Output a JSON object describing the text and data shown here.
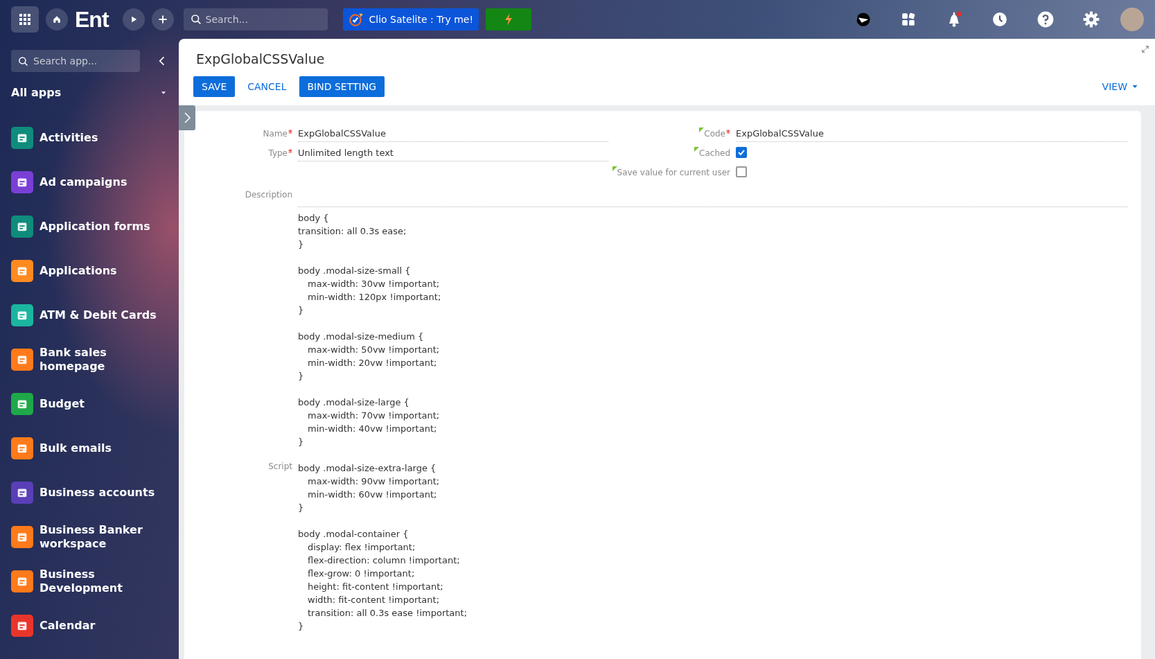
{
  "topbar": {
    "logo": "Ent",
    "search": {
      "placeholder": "Search..."
    },
    "promo_button": "Clio Satelite : Try me!",
    "notification_dot": true
  },
  "sidebar": {
    "search": {
      "placeholder": "Search app..."
    },
    "group": "All apps",
    "items": [
      {
        "label": "Activities",
        "color": "#0f8c7c"
      },
      {
        "label": "Ad campaigns",
        "color": "#7a3fd6"
      },
      {
        "label": "Application forms",
        "color": "#0f8c7c"
      },
      {
        "label": "Applications",
        "color": "#ff8a1f"
      },
      {
        "label": "ATM & Debit Cards",
        "color": "#1bb5a0"
      },
      {
        "label": "Bank sales homepage",
        "color": "#ff7a1a"
      },
      {
        "label": "Budget",
        "color": "#1fa84a"
      },
      {
        "label": "Bulk emails",
        "color": "#ff7a1a"
      },
      {
        "label": "Business accounts",
        "color": "#5a3fb8"
      },
      {
        "label": "Business Banker workspace",
        "color": "#ff7a1a"
      },
      {
        "label": "Business Development",
        "color": "#ff7a1a"
      },
      {
        "label": "Calendar",
        "color": "#e8352c"
      }
    ]
  },
  "page": {
    "title": "ExpGlobalCSSValue",
    "buttons": [
      {
        "label": "SAVE",
        "kind": "primary"
      },
      {
        "label": "CANCEL",
        "kind": "link"
      },
      {
        "label": "BIND SETTING",
        "kind": "primary"
      }
    ],
    "view_button": "VIEW"
  },
  "form": {
    "left_fields": [
      {
        "label": "Name",
        "required": true,
        "marked": false,
        "value": "ExpGlobalCSSValue"
      },
      {
        "label": "Type",
        "required": true,
        "marked": false,
        "value": "Unlimited length text"
      }
    ],
    "right_fields": [
      {
        "label": "Code",
        "kind": "text",
        "required": true,
        "marked": true,
        "value": "ExpGlobalCSSValue"
      },
      {
        "label": "Cached",
        "kind": "checkbox",
        "required": false,
        "marked": true,
        "checked": true
      },
      {
        "label": "Save value for current user",
        "kind": "checkbox",
        "required": false,
        "marked": true,
        "checked": false
      }
    ],
    "description": {
      "label": "Description"
    },
    "script": {
      "label": "Script",
      "blocks": [
        [
          {
            "text": "body {",
            "indent": false
          },
          {
            "text": "transition: all 0.3s ease;",
            "indent": false
          },
          {
            "text": "}",
            "indent": false
          }
        ],
        [
          {
            "text": "body .modal-size-small {",
            "indent": false
          },
          {
            "text": "max-width: 30vw !important;",
            "indent": true
          },
          {
            "text": "min-width: 120px !important;",
            "indent": true
          },
          {
            "text": "}",
            "indent": false
          }
        ],
        [
          {
            "text": "body .modal-size-medium {",
            "indent": false
          },
          {
            "text": "max-width: 50vw !important;",
            "indent": true
          },
          {
            "text": "min-width: 20vw !important;",
            "indent": true
          },
          {
            "text": "}",
            "indent": false
          }
        ],
        [
          {
            "text": "body .modal-size-large {",
            "indent": false
          },
          {
            "text": "max-width: 70vw !important;",
            "indent": true
          },
          {
            "text": "min-width: 40vw !important;",
            "indent": true
          },
          {
            "text": "}",
            "indent": false
          }
        ],
        [
          {
            "text": "body .modal-size-extra-large {",
            "indent": false
          },
          {
            "text": "max-width: 90vw !important;",
            "indent": true
          },
          {
            "text": "min-width: 60vw !important;",
            "indent": true
          },
          {
            "text": "}",
            "indent": false
          }
        ],
        [
          {
            "text": "body .modal-container {",
            "indent": false
          },
          {
            "text": "display: flex !important;",
            "indent": true
          },
          {
            "text": "flex-direction: column !important;",
            "indent": true
          },
          {
            "text": "flex-grow: 0 !important;",
            "indent": true
          },
          {
            "text": "height: fit-content !important;",
            "indent": true
          },
          {
            "text": "width: fit-content !important;",
            "indent": true
          },
          {
            "text": "transition: all 0.3s ease !important;",
            "indent": true
          },
          {
            "text": "}",
            "indent": false
          }
        ]
      ]
    }
  }
}
